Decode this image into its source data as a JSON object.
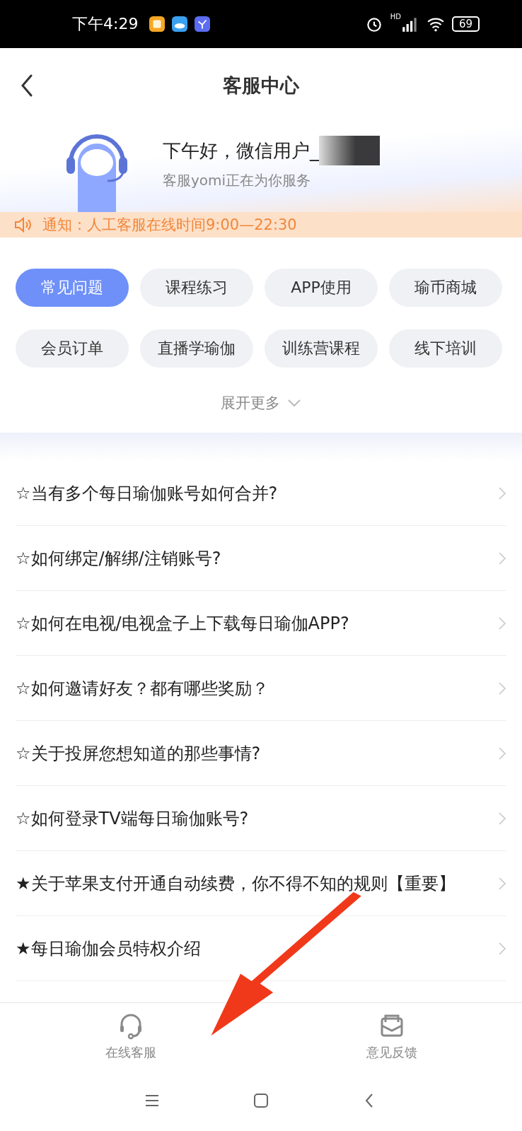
{
  "status_bar": {
    "time": "下午4:29",
    "network": "HD",
    "battery": "69"
  },
  "header": {
    "title": "客服中心"
  },
  "hero": {
    "greeting": "下午好，微信用户_",
    "subtitle": "客服yomi正在为你服务"
  },
  "notice": {
    "text": "通知：人工客服在线时间9:00—22:30"
  },
  "categories": [
    {
      "label": "常见问题",
      "selected": true
    },
    {
      "label": "课程练习",
      "selected": false
    },
    {
      "label": "APP使用",
      "selected": false
    },
    {
      "label": "瑜币商城",
      "selected": false
    },
    {
      "label": "会员订单",
      "selected": false
    },
    {
      "label": "直播学瑜伽",
      "selected": false
    },
    {
      "label": "训练营课程",
      "selected": false
    },
    {
      "label": "线下培训",
      "selected": false
    }
  ],
  "expand_more": "展开更多",
  "questions": [
    "☆当有多个每日瑜伽账号如何合并?",
    "☆如何绑定/解绑/注销账号?",
    "☆如何在电视/电视盒子上下载每日瑜伽APP?",
    "☆如何邀请好友？都有哪些奖励？",
    "☆关于投屏您想知道的那些事情?",
    "☆如何登录TV端每日瑜伽账号?",
    "★关于苹果支付开通自动续费，你不得不知的规则【重要】",
    "★每日瑜伽会员特权介绍"
  ],
  "bottom_tabs": [
    {
      "kind": "headset",
      "label": "在线客服"
    },
    {
      "kind": "mail",
      "label": "意见反馈"
    }
  ]
}
